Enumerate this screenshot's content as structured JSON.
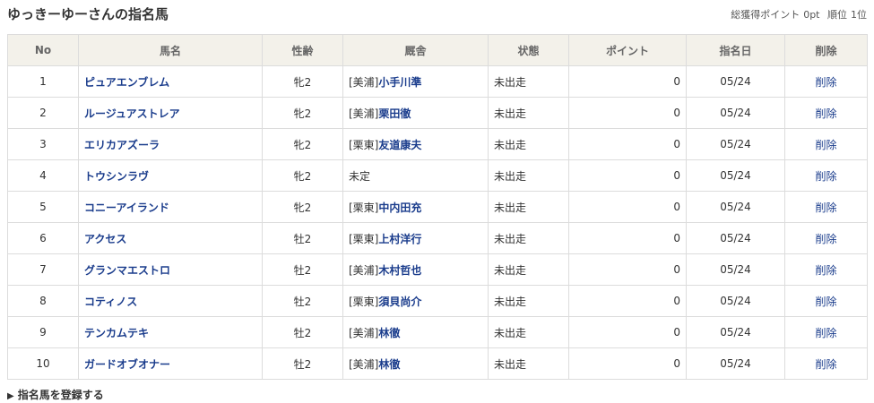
{
  "header": {
    "title": "ゆっきーゆーさんの指名馬",
    "points_label": "総獲得ポイント",
    "points_value": "0pt",
    "rank_label": "順位",
    "rank_value": "1位"
  },
  "table": {
    "columns": [
      "No",
      "馬名",
      "性齢",
      "厩舎",
      "状態",
      "ポイント",
      "指名日",
      "削除"
    ],
    "rows": [
      {
        "no": "1",
        "name": "ピュアエンブレム",
        "sexage": "牝2",
        "stable_prefix": "[美浦]",
        "trainer": "小手川準",
        "status": "未出走",
        "points": "0",
        "date": "05/24",
        "delete": "削除"
      },
      {
        "no": "2",
        "name": "ルージュアストレア",
        "sexage": "牝2",
        "stable_prefix": "[美浦]",
        "trainer": "栗田徹",
        "status": "未出走",
        "points": "0",
        "date": "05/24",
        "delete": "削除"
      },
      {
        "no": "3",
        "name": "エリカアズーラ",
        "sexage": "牝2",
        "stable_prefix": "[栗東]",
        "trainer": "友道康夫",
        "status": "未出走",
        "points": "0",
        "date": "05/24",
        "delete": "削除"
      },
      {
        "no": "4",
        "name": "トウシンラヴ",
        "sexage": "牝2",
        "stable_prefix": "未定",
        "trainer": "",
        "status": "未出走",
        "points": "0",
        "date": "05/24",
        "delete": "削除"
      },
      {
        "no": "5",
        "name": "コニーアイランド",
        "sexage": "牝2",
        "stable_prefix": "[栗東]",
        "trainer": "中内田充",
        "status": "未出走",
        "points": "0",
        "date": "05/24",
        "delete": "削除"
      },
      {
        "no": "6",
        "name": "アクセス",
        "sexage": "牡2",
        "stable_prefix": "[栗東]",
        "trainer": "上村洋行",
        "status": "未出走",
        "points": "0",
        "date": "05/24",
        "delete": "削除"
      },
      {
        "no": "7",
        "name": "グランマエストロ",
        "sexage": "牡2",
        "stable_prefix": "[美浦]",
        "trainer": "木村哲也",
        "status": "未出走",
        "points": "0",
        "date": "05/24",
        "delete": "削除"
      },
      {
        "no": "8",
        "name": "コティノス",
        "sexage": "牡2",
        "stable_prefix": "[栗東]",
        "trainer": "須貝尚介",
        "status": "未出走",
        "points": "0",
        "date": "05/24",
        "delete": "削除"
      },
      {
        "no": "9",
        "name": "テンカムテキ",
        "sexage": "牡2",
        "stable_prefix": "[美浦]",
        "trainer": "林徹",
        "status": "未出走",
        "points": "0",
        "date": "05/24",
        "delete": "削除"
      },
      {
        "no": "10",
        "name": "ガードオブオナー",
        "sexage": "牡2",
        "stable_prefix": "[美浦]",
        "trainer": "林徹",
        "status": "未出走",
        "points": "0",
        "date": "05/24",
        "delete": "削除"
      }
    ]
  },
  "footer": {
    "register_label": "指名馬を登録する",
    "register_icon": "triangle-right-icon"
  },
  "colors": {
    "link": "#1a3c8c",
    "header_bg": "#f3f1ea",
    "border": "#dcdcdc"
  }
}
